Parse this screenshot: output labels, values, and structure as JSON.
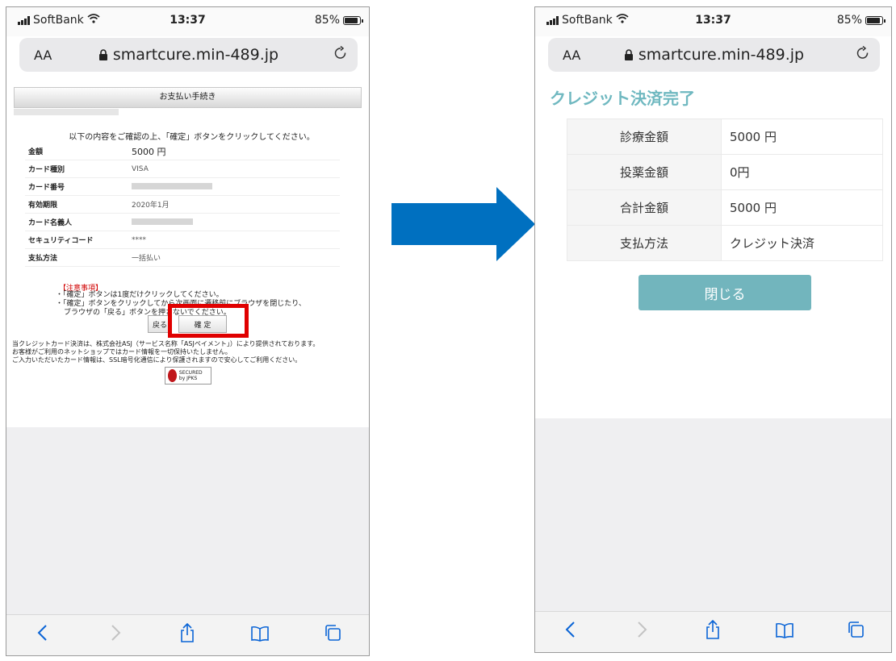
{
  "colors": {
    "arrow": "#0070c0",
    "highlight": "#e00000",
    "accent": "#72b5bd",
    "title_accent": "#6fb8c0",
    "nav_blue": "#0a64d6"
  },
  "status": {
    "carrier": "SoftBank",
    "time": "13:37",
    "battery": "85%"
  },
  "browser": {
    "aa": "AA",
    "url": "smartcure.min-489.jp",
    "icons": [
      "lock-icon",
      "reload-icon",
      "back-icon",
      "forward-icon",
      "share-icon",
      "bookmarks-icon",
      "tabs-icon"
    ]
  },
  "left": {
    "header": "お支払い手続き",
    "intro": "以下の内容をご確認の上、「確定」ボタンをクリックしてください。",
    "rows": [
      {
        "label": "金額",
        "value": "5000 円"
      },
      {
        "label": "カード種別",
        "value": "VISA"
      },
      {
        "label": "カード番号",
        "value": ""
      },
      {
        "label": "有効期限",
        "value": "2020年1月"
      },
      {
        "label": "カード名義人",
        "value": ""
      },
      {
        "label": "セキュリティコード",
        "value": "****"
      },
      {
        "label": "支払方法",
        "value": "一括払い"
      }
    ],
    "note_title": "【注意事項】",
    "notes": [
      "・「確定」ボタンは1度だけクリックしてください。",
      "・「確定」ボタンをクリックしてから次画面に遷移前にブラウザを閉じたり、",
      "ブラウザの「戻る」ボタンを押さないでください。"
    ],
    "back_button": "戻る",
    "confirm_button": "確 定",
    "footer": [
      "当クレジットカード決済は、株式会社ASJ（サービス名称「ASJペイメント」）により提供されております。",
      "お客様がご利用のネットショップではカード情報を一切保持いたしません。",
      "ご入力いただいたカード情報は、SSL暗号化通信により保護されますので安心してご利用ください。"
    ],
    "seal": "SECURED by JPKS"
  },
  "right": {
    "title": "クレジット決済完了",
    "rows": [
      {
        "label": "診療金額",
        "value": "5000 円"
      },
      {
        "label": "投薬金額",
        "value": "0円"
      },
      {
        "label": "合計金額",
        "value": "5000 円"
      },
      {
        "label": "支払方法",
        "value": "クレジット決済"
      }
    ],
    "close_button": "閉じる"
  }
}
